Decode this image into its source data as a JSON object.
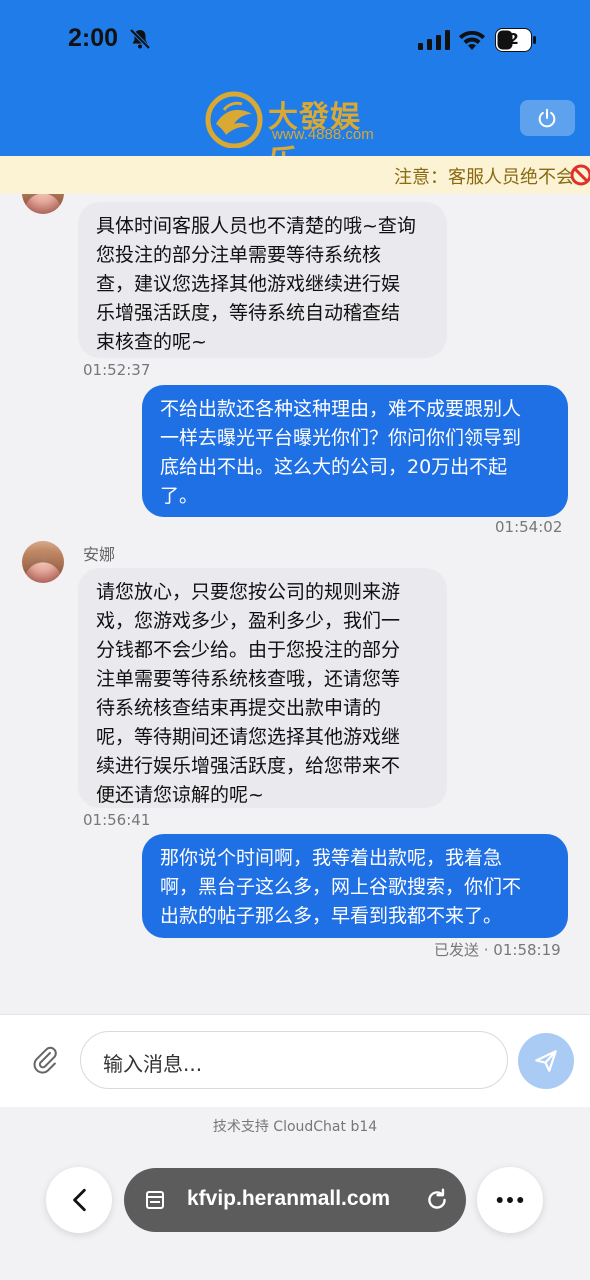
{
  "status_bar": {
    "time": "2:00",
    "battery": "42"
  },
  "header": {
    "brand_name": "大發娱乐",
    "brand_url": "www.4888.com"
  },
  "notice": {
    "text": "注意：客服人员绝不会"
  },
  "messages": [
    {
      "text": "具体时间客服人员也不清楚的哦~查询\n您投注的部分注单需要等待系统核\n查，建议您选择其他游戏继续进行娱\n乐增强活跃度，等待系统自动稽查结\n束核查的呢~",
      "time": "01:52:37"
    },
    {
      "text": "不给出款还各种这种理由，难不成要跟别人\n一样去曝光平台曝光你们？你问你们领导到\n底给出不出。这么大的公司，20万出不起\n了。",
      "time": "01:54:02"
    },
    {
      "sender": "安娜",
      "text": "请您放心，只要您按公司的规则来游\n戏，您游戏多少，盈利多少，我们一\n分钱都不会少给。由于您投注的部分\n注单需要等待系统核查哦，还请您等\n待系统核查结束再提交出款申请的\n呢，等待期间还请您选择其他游戏继\n续进行娱乐增强活跃度，给您带来不\n便还请您谅解的呢~",
      "time": "01:56:41"
    },
    {
      "text": "那你说个时间啊，我等着出款呢，我着急\n啊，黑台子这么多，网上谷歌搜索，你们不\n出款的帖子那么多，早看到我都不来了。",
      "time": "已发送 · 01:58:19"
    }
  ],
  "composer": {
    "placeholder": "输入消息..."
  },
  "footer": {
    "powered_by": "技术支持 CloudChat b14"
  },
  "browser": {
    "url": "kfvip.heranmall.com"
  },
  "colors": {
    "header": "#1f7ce8",
    "outgoing_bubble": "#1f6fe5",
    "incoming_bubble": "#e9e9ee",
    "brand_gold": "#d9a933",
    "notice_bg": "#fbf3d4"
  },
  "icons": [
    "bell-slash-icon",
    "signal-icon",
    "wifi-icon",
    "battery-icon",
    "power-icon",
    "prohibited-icon",
    "paperclip-icon",
    "send-icon",
    "back-icon",
    "tabs-icon",
    "reload-icon",
    "more-icon"
  ]
}
